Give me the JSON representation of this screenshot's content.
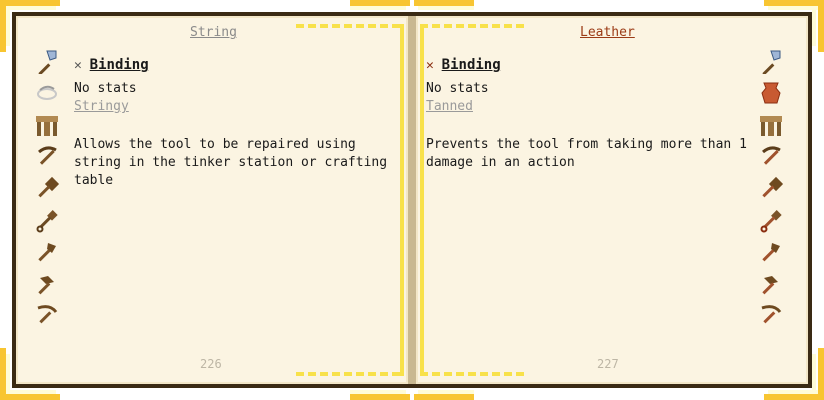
{
  "left_page": {
    "title": "String",
    "section": "Binding",
    "stats": "No stats",
    "trait": "Stringy",
    "description_lines": [
      "Allows the tool to be repaired using",
      "string in the tinker station or crafting",
      "table"
    ],
    "page_number": "226",
    "icons": [
      "axe-icon",
      "string-icon",
      "table-icon",
      "pickaxe-icon",
      "hammer-icon",
      "shovel-icon",
      "hatchet-icon",
      "mattock-icon",
      "scythe-icon"
    ]
  },
  "right_page": {
    "title": "Leather",
    "section": "Binding",
    "stats": "No stats",
    "trait": "Tanned",
    "description_lines": [
      "Prevents the tool from taking more than 1",
      "damage in an action"
    ],
    "page_number": "227",
    "icons": [
      "axe-icon",
      "leather-icon",
      "table-icon",
      "pickaxe-icon",
      "hammer-icon",
      "shovel-icon",
      "hatchet-icon",
      "mattock-icon",
      "scythe-icon"
    ]
  },
  "colors": {
    "page": "#fbf4e2",
    "frame": "#f8e14a",
    "border": "#3a2a14",
    "accent_right_title": "#9b3b16"
  }
}
